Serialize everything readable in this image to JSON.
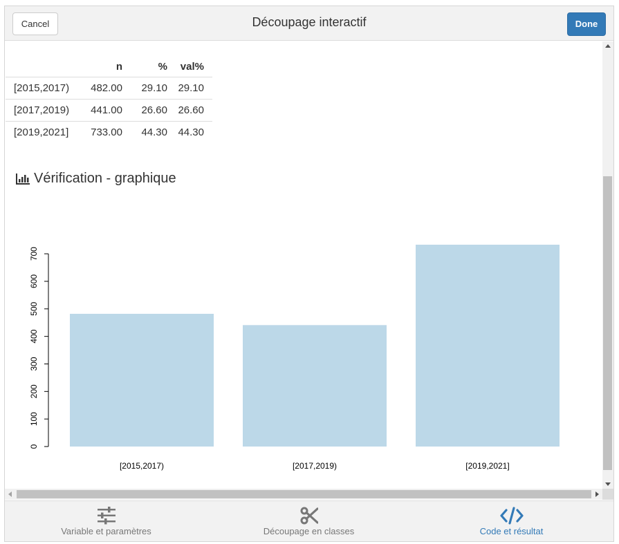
{
  "dialog": {
    "title": "Découpage interactif",
    "cancel_label": "Cancel",
    "done_label": "Done"
  },
  "table": {
    "headers": [
      "",
      "n",
      "%",
      "val%"
    ],
    "rows": [
      {
        "label": "[2015,2017)",
        "n": "482.00",
        "pct": "29.10",
        "valpct": "29.10"
      },
      {
        "label": "[2017,2019)",
        "n": "441.00",
        "pct": "26.60",
        "valpct": "26.60"
      },
      {
        "label": "[2019,2021]",
        "n": "733.00",
        "pct": "44.30",
        "valpct": "44.30"
      }
    ]
  },
  "section": {
    "title": "Vérification - graphique",
    "icon": "bar-chart-icon"
  },
  "chart_data": {
    "type": "bar",
    "categories": [
      "[2015,2017)",
      "[2017,2019)",
      "[2019,2021]"
    ],
    "values": [
      482,
      441,
      733
    ],
    "ylim": [
      0,
      733
    ],
    "yticks": [
      0,
      100,
      200,
      300,
      400,
      500,
      600,
      700
    ],
    "bar_color": "#bcd8e8",
    "grid": false
  },
  "tabs": [
    {
      "label": "Variable et paramètres",
      "icon": "sliders-icon",
      "active": false
    },
    {
      "label": "Découpage en classes",
      "icon": "scissors-icon",
      "active": false
    },
    {
      "label": "Code et résultat",
      "icon": "code-icon",
      "active": true
    }
  ],
  "colors": {
    "accent": "#337ab7",
    "tab_inactive": "#777777"
  }
}
